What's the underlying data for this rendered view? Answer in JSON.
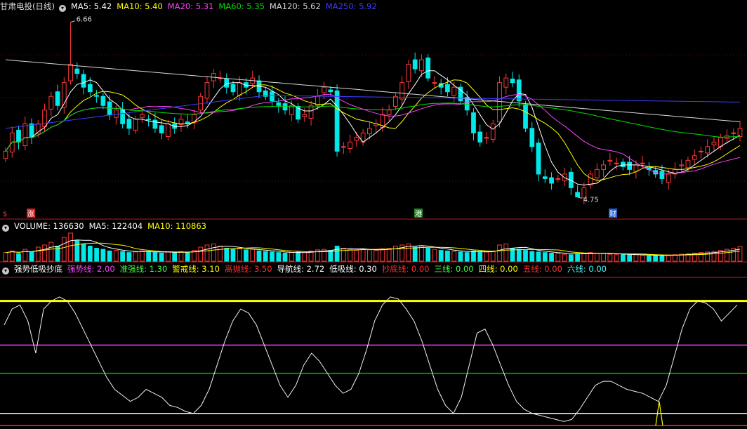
{
  "title": "甘肃电投(日线)",
  "ma_header": [
    {
      "label": "MA5: 5.42",
      "color": "#ffffff"
    },
    {
      "label": "MA10: 5.40",
      "color": "#ffff00"
    },
    {
      "label": "MA20: 5.31",
      "color": "#ff40ff"
    },
    {
      "label": "MA60: 5.35",
      "color": "#00e000"
    },
    {
      "label": "MA120: 5.62",
      "color": "#d8d8d8"
    },
    {
      "label": "MA250: 5.92",
      "color": "#3c3cff"
    }
  ],
  "markers": [
    {
      "text": "$",
      "color": "#ff3030"
    },
    {
      "text": "涨",
      "color": "#ffffff",
      "bg": "#d02020"
    },
    {
      "text": "港",
      "color": "#ffffff",
      "bg": "#208a20"
    },
    {
      "text": "财",
      "color": "#ffffff",
      "bg": "#2060d0"
    }
  ],
  "volume_header": [
    {
      "label": "VOLUME: 136630",
      "color": "#ffffff"
    },
    {
      "label": "MA5: 122404",
      "color": "#ffffff"
    },
    {
      "label": "MA10: 110863",
      "color": "#ffff00"
    }
  ],
  "indicator_header": [
    {
      "label": "强势低吸抄底",
      "color": "#ffffff"
    },
    {
      "label": "强势线: 2.00",
      "color": "#ff40ff"
    },
    {
      "label": "准强线: 1.30",
      "color": "#40ff40"
    },
    {
      "label": "警戒线: 3.10",
      "color": "#ffff00"
    },
    {
      "label": "高抛线: 3.50",
      "color": "#ff3030"
    },
    {
      "label": "导航线: 2.72",
      "color": "#ffffff"
    },
    {
      "label": "低吸线: 0.30",
      "color": "#ffffff"
    },
    {
      "label": "抄底线: 0.00",
      "color": "#ff3030"
    },
    {
      "label": "三线: 0.00",
      "color": "#40ff40"
    },
    {
      "label": "四线: 0.00",
      "color": "#ffff00"
    },
    {
      "label": "五线: 0.00",
      "color": "#ff3030"
    },
    {
      "label": "六线: 0.00",
      "color": "#40ffff"
    }
  ],
  "chart_data": [
    {
      "type": "candlestick",
      "title": "甘肃电投(日线)",
      "ylim": [
        4.6,
        6.75
      ],
      "annotations": [
        {
          "text": "6.66",
          "value": 6.66
        },
        {
          "text": "4.75",
          "value": 4.75
        }
      ],
      "close": [
        5.25,
        5.45,
        5.35,
        5.55,
        5.4,
        5.55,
        5.7,
        5.85,
        5.75,
        6.0,
        6.2,
        6.1,
        5.95,
        5.9,
        5.85,
        5.75,
        5.65,
        5.7,
        5.55,
        5.5,
        5.6,
        5.65,
        5.6,
        5.5,
        5.45,
        5.55,
        5.5,
        5.6,
        5.55,
        5.65,
        5.85,
        6.0,
        6.1,
        6.05,
        5.95,
        5.9,
        6.0,
        5.95,
        6.05,
        5.9,
        5.85,
        5.8,
        5.75,
        5.7,
        5.75,
        5.6,
        5.65,
        5.75,
        5.85,
        5.95,
        5.9,
        5.25,
        5.3,
        5.35,
        5.4,
        5.45,
        5.5,
        5.55,
        5.65,
        5.7,
        5.85,
        6.0,
        6.2,
        6.15,
        6.25,
        6.05,
        6.0,
        5.95,
        5.9,
        5.95,
        5.8,
        5.7,
        5.45,
        5.35,
        5.4,
        5.55,
        6.0,
        6.05,
        6.0,
        5.8,
        5.5,
        5.3,
        5.0,
        4.95,
        4.9,
        4.95,
        5.0,
        4.85,
        4.75,
        4.85,
        5.0,
        5.05,
        5.1,
        5.15,
        5.12,
        5.08,
        5.05,
        5.1,
        5.12,
        5.05,
        5.0,
        4.95,
        5.0,
        5.05,
        5.1,
        5.15,
        5.2,
        5.25,
        5.3,
        5.35,
        5.4,
        5.42,
        5.45,
        5.5
      ]
    },
    {
      "type": "bar",
      "title": "VOLUME",
      "values": [
        80,
        95,
        70,
        110,
        85,
        130,
        150,
        175,
        140,
        220,
        260,
        190,
        160,
        140,
        120,
        110,
        95,
        100,
        90,
        80,
        85,
        95,
        90,
        80,
        75,
        85,
        80,
        90,
        85,
        100,
        130,
        150,
        160,
        140,
        120,
        110,
        115,
        105,
        110,
        95,
        90,
        85,
        80,
        75,
        80,
        85,
        80,
        95,
        105,
        110,
        100,
        140,
        120,
        110,
        100,
        110,
        105,
        100,
        115,
        120,
        140,
        150,
        160,
        130,
        140,
        120,
        110,
        100,
        95,
        90,
        85,
        80,
        95,
        90,
        85,
        90,
        150,
        160,
        120,
        110,
        100,
        90,
        85,
        80,
        75,
        70,
        65,
        60,
        70,
        75,
        80,
        75,
        70,
        65,
        60,
        62,
        58,
        60,
        55,
        50,
        52,
        55,
        58,
        60,
        65,
        70,
        75,
        80,
        85,
        90,
        100,
        110,
        120,
        137
      ]
    },
    {
      "type": "line",
      "title": "强势低吸抄底",
      "ylim": [
        0,
        3.6
      ],
      "reference_lines": [
        {
          "name": "警戒线",
          "value": 3.1
        },
        {
          "name": "强势线",
          "value": 2.0
        },
        {
          "name": "准强线",
          "value": 1.3
        },
        {
          "name": "低吸线",
          "value": 0.3
        },
        {
          "name": "抄底线",
          "value": 0.0
        }
      ],
      "values": [
        2.5,
        2.9,
        3.0,
        2.6,
        1.8,
        2.9,
        3.1,
        3.2,
        3.1,
        2.8,
        2.4,
        2.0,
        1.6,
        1.2,
        0.9,
        0.75,
        0.6,
        0.7,
        0.9,
        0.8,
        0.7,
        0.5,
        0.45,
        0.35,
        0.3,
        0.5,
        0.9,
        1.5,
        2.1,
        2.6,
        2.9,
        2.8,
        2.5,
        2.0,
        1.5,
        1.0,
        0.7,
        1.0,
        1.5,
        1.8,
        1.6,
        1.3,
        1.0,
        0.8,
        0.9,
        1.3,
        1.9,
        2.6,
        3.0,
        3.2,
        3.15,
        2.9,
        2.6,
        2.1,
        1.5,
        0.9,
        0.5,
        0.3,
        0.7,
        1.5,
        2.3,
        2.4,
        2.0,
        1.5,
        1.0,
        0.6,
        0.4,
        0.3,
        0.25,
        0.2,
        0.15,
        0.1,
        0.15,
        0.4,
        0.7,
        1.0,
        1.1,
        1.1,
        1.0,
        0.9,
        0.85,
        0.8,
        0.7,
        0.6,
        1.0,
        1.7,
        2.4,
        2.9,
        3.1,
        3.05,
        2.9,
        2.6,
        2.8,
        3.0
      ]
    }
  ]
}
